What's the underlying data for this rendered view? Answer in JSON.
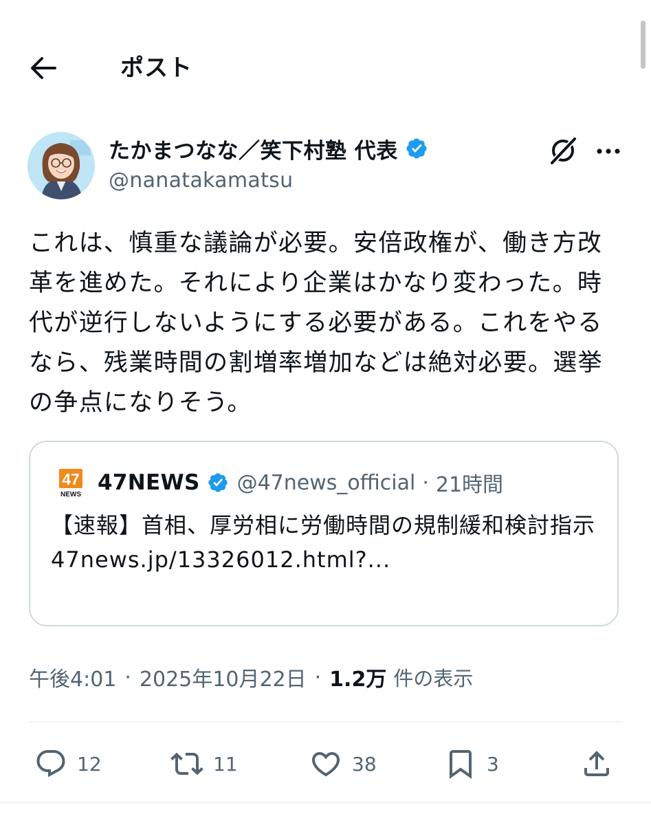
{
  "header": {
    "back_icon": "arrow-left-icon",
    "title": "ポスト"
  },
  "author": {
    "name": "たかまつなな／笑下村塾 代表",
    "handle": "@nanatakamatsu",
    "verified": true
  },
  "post": {
    "text": "これは、慎重な議論が必要。安倍政権が、働き方改革を進めた。それにより企業はかなり変わった。時代が逆行しないようにする必要がある。これをやるなら、残業時間の割増率増加などは絶対必要。選挙の争点になりそう。"
  },
  "quote": {
    "logo_number": "47",
    "logo_word": "NEWS",
    "name": "47NEWS",
    "handle": "@47news_official",
    "separator": "·",
    "time": "21時間",
    "text": "【速報】首相、厚労相に労働時間の規制緩和検討指示",
    "link": "47news.jp/13326012.html?..."
  },
  "meta": {
    "time": "午後4:01",
    "separator": "·",
    "date": "2025年10月22日",
    "views_count": "1.2万",
    "views_label": "件の表示"
  },
  "actions": {
    "replies": "12",
    "reposts": "11",
    "likes": "38",
    "bookmarks": "3"
  },
  "colors": {
    "text": "#0f1419",
    "secondary": "#536471",
    "verified_blue": "#1d9bf0",
    "border": "#cfd9de",
    "news_orange": "#f08a1c"
  }
}
